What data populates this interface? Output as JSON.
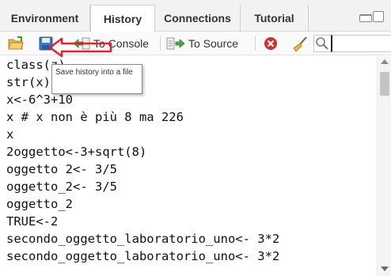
{
  "tabs": [
    {
      "label": "Environment"
    },
    {
      "label": "History"
    },
    {
      "label": "Connections"
    },
    {
      "label": "Tutorial"
    }
  ],
  "active_tab": "History",
  "toolbar": {
    "open_icon": "open-folder-icon",
    "save_icon": "floppy-disk-icon",
    "console_label": "To Console",
    "source_label": "To Source",
    "delete_icon": "remove-entry-icon",
    "clear_icon": "broom-icon",
    "search_icon": "magnifier-icon",
    "search_value": ""
  },
  "tooltip": {
    "text": "Save history into a file"
  },
  "annotation": {
    "color": "#e8202a",
    "shape": "arrow-pointing-left"
  },
  "history": [
    "class(z)",
    "str(x)",
    "x<-6^3+10",
    "x # x non è più 8 ma 226",
    "x",
    "2oggetto<-3+sqrt(8)",
    "oggetto 2<- 3/5",
    "oggetto_2<- 3/5",
    "oggetto_2",
    "TRUE<-2",
    "secondo_oggetto_laboratorio_uno<- 3*2",
    "secondo_oggetto_laboratorio_uno<- 3*2"
  ],
  "colors": {
    "tab_bg": "#f2f2f2",
    "active_tab_bg": "#ffffff",
    "annotation_red": "#e8202a",
    "delete_red": "#d32f2f"
  }
}
